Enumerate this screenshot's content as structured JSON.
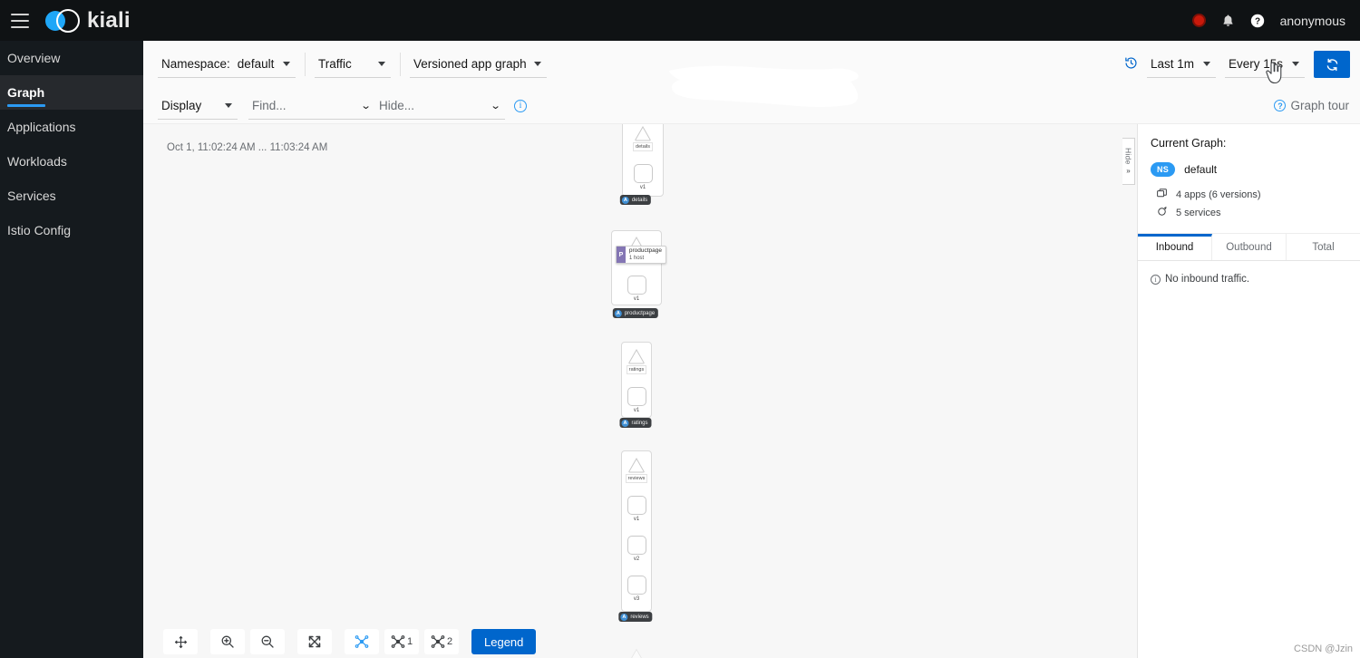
{
  "masthead": {
    "menu_icon": "hamburger-icon",
    "brand": "kiali",
    "record_icon": "record-indicator-icon",
    "bell_icon": "bell-icon",
    "help_icon": "help-circle-icon",
    "user": "anonymous"
  },
  "sidebar": {
    "items": [
      {
        "label": "Overview",
        "active": false
      },
      {
        "label": "Graph",
        "active": true
      },
      {
        "label": "Applications",
        "active": false
      },
      {
        "label": "Workloads",
        "active": false
      },
      {
        "label": "Services",
        "active": false
      },
      {
        "label": "Istio Config",
        "active": false
      }
    ]
  },
  "toolbar": {
    "namespace_label": "Namespace:",
    "namespace_value": "default",
    "traffic": "Traffic",
    "graph_type": "Versioned app graph",
    "time_range": "Last 1m",
    "refresh_interval": "Every 15s",
    "refresh_icon": "sync-icon",
    "history_icon": "history-clock-icon"
  },
  "toolbar2": {
    "display": "Display",
    "find_placeholder": "Find...",
    "hide_placeholder": "Hide...",
    "info_icon": "info-circle-icon",
    "graph_tour": "Graph tour"
  },
  "canvas": {
    "timestamp": "Oct 1, 11:02:24 AM ... 11:03:24 AM",
    "hide_handle": "Hide",
    "hide_chevron": "»",
    "nodes": [
      {
        "app": "details",
        "service": "details",
        "versions": [
          "v1"
        ],
        "badge_icon": "app-icon"
      },
      {
        "app": "productpage",
        "service": "productpage",
        "versions": [
          "v1"
        ],
        "badge_icon": "app-icon",
        "tooltip": {
          "tag": "P",
          "line1": "productpage",
          "line2": "1 host"
        }
      },
      {
        "app": "ratings",
        "service": "ratings",
        "versions": [
          "v1"
        ],
        "badge_icon": "app-icon"
      },
      {
        "app": "reviews",
        "service": "reviews",
        "versions": [
          "v1",
          "v2",
          "v3"
        ],
        "badge_icon": "app-icon"
      }
    ]
  },
  "side_panel": {
    "title": "Current Graph:",
    "ns_badge": "NS",
    "ns_name": "default",
    "apps_icon": "apps-icon",
    "apps_text": "4 apps (6 versions)",
    "services_icon": "service-icon",
    "services_text": "5 services",
    "tabs": [
      {
        "label": "Inbound",
        "active": true
      },
      {
        "label": "Outbound",
        "active": false
      },
      {
        "label": "Total",
        "active": false
      }
    ],
    "empty_message": "No inbound traffic."
  },
  "graph_tools": {
    "buttons": [
      {
        "name": "pan-icon",
        "glyph": "✥",
        "count": ""
      },
      {
        "name": "zoom-in-icon",
        "glyph": "⊕",
        "count": ""
      },
      {
        "name": "zoom-out-icon",
        "glyph": "⊖",
        "count": ""
      },
      {
        "name": "fit-screen-icon",
        "glyph": "⤧",
        "count": ""
      },
      {
        "name": "layout-default-icon",
        "glyph": "✻",
        "count": ""
      },
      {
        "name": "layout-1-icon",
        "glyph": "✻",
        "count": "1"
      },
      {
        "name": "layout-2-icon",
        "glyph": "✻",
        "count": "2"
      }
    ],
    "legend": "Legend"
  },
  "watermark": "CSDN @Jzin",
  "colors": {
    "accent_blue": "#0066cc",
    "light_blue": "#2b9af3",
    "masthead_bg": "#0f1214",
    "sidebar_bg": "#151a1e"
  }
}
